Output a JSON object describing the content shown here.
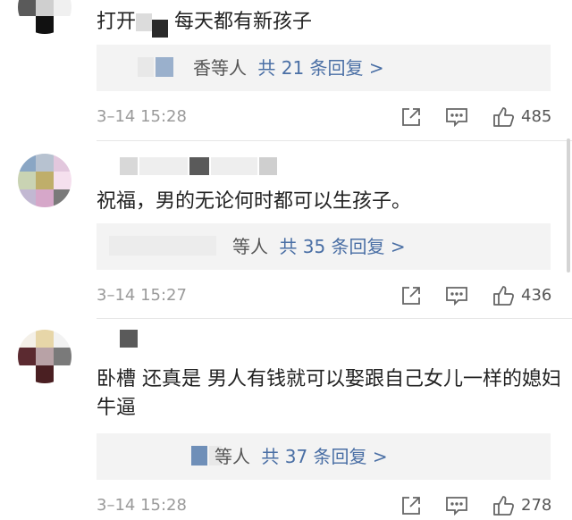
{
  "colors": {
    "link": "#4a6fa5",
    "text": "#222222",
    "meta": "#9a9a9a",
    "reply_box_bg": "#f3f3f3"
  },
  "comments": [
    {
      "content": "打开",
      "content_tail": "每天都有新孩子",
      "replies_prefix": "香等人",
      "replies_link": "共 21 条回复 >",
      "timestamp": "3–14 15:28",
      "likes": "485"
    },
    {
      "content": "祝福，男的无论何时都可以生孩子。",
      "replies_prefix": "等人",
      "replies_link": "共 35 条回复 >",
      "timestamp": "3–14 15:27",
      "likes": "436"
    },
    {
      "content": "卧槽 还真是 男人有钱就可以娶跟自己女儿一样的媳妇 牛逼",
      "replies_prefix": "等人",
      "replies_link": "共 37 条回复 >",
      "timestamp": "3–14 15:28",
      "likes": "278"
    }
  ],
  "icons": {
    "share": "share-icon",
    "comment": "comment-icon",
    "like": "thumbs-up-icon"
  }
}
